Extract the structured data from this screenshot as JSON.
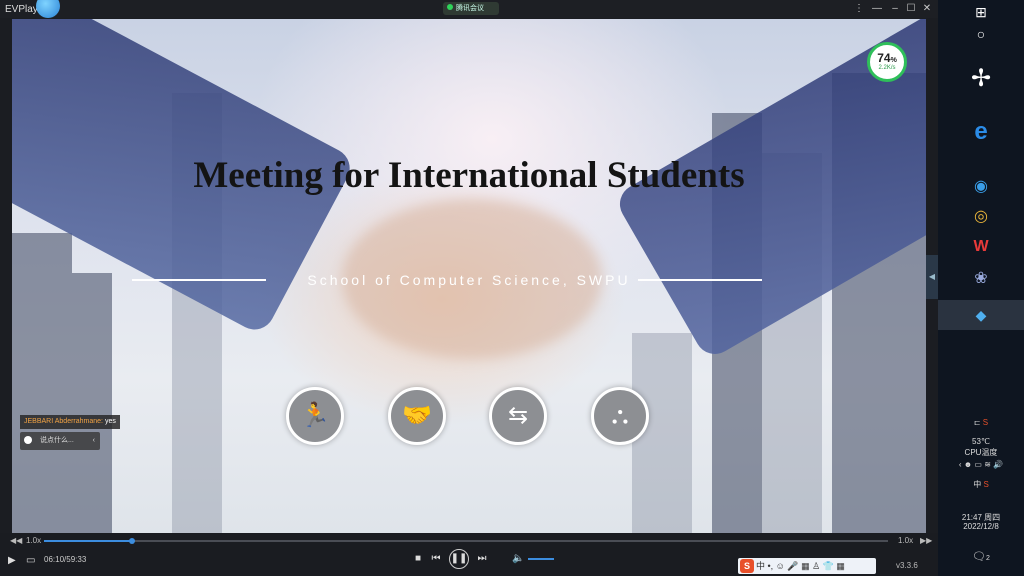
{
  "titlebar": {
    "title": "EVPlayer",
    "meeting_tag": "腾讯会议"
  },
  "slide": {
    "headline": "Meeting for International Students",
    "subline": "School of Computer Science, SWPU"
  },
  "network_badge": {
    "percent": "74",
    "percent_sign": "%",
    "speed": "2.2K/s"
  },
  "chat": {
    "sender": "JEBBARI Abderrahmane:",
    "message": "yes",
    "input_placeholder": "说点什么..."
  },
  "player": {
    "speed_left": "1.0x",
    "speed_right": "1.0x",
    "time": "06:10/59:33",
    "progress": 0.104,
    "version": "v3.3.6"
  },
  "ime": {
    "label": "中"
  },
  "system_tray": {
    "cpu_temp": "53℃",
    "cpu_label": "CPU温度",
    "ime_short": "中",
    "clock_time": "21:47 周四",
    "clock_date": "2022/12/8",
    "notif_count": "2"
  },
  "icons": [
    "play-icon",
    "stop-icon",
    "prev-icon",
    "pause-icon",
    "next-icon",
    "volume-icon",
    "windows-icon",
    "search-icon",
    "pinwheel-icon",
    "ie-icon",
    "edge-icon",
    "chrome-icon",
    "wps-icon",
    "flower-icon",
    "tencent-meeting-icon"
  ]
}
